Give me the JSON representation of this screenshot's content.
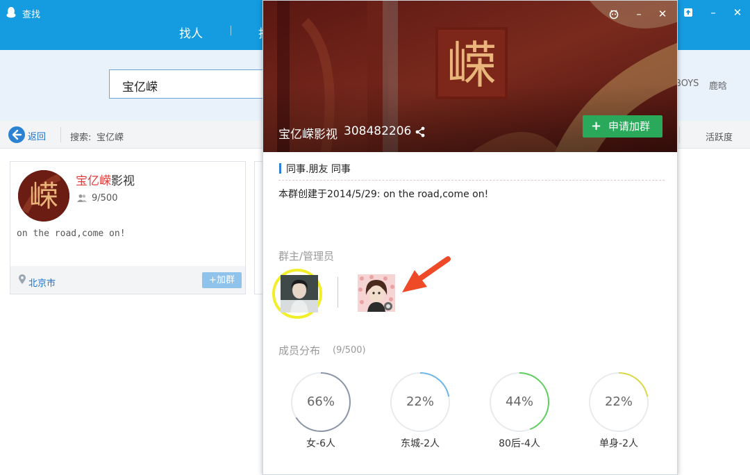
{
  "window": {
    "title": "查找",
    "nav_tabs": [
      "找人",
      "找群"
    ],
    "controls": [
      "skin-icon",
      "minimize-icon",
      "close-icon"
    ]
  },
  "search": {
    "value": "宝亿嵘",
    "hot_tags": [
      "BOYS",
      "鹿晗"
    ]
  },
  "toolbar": {
    "back_label": "返回",
    "search_prefix": "搜索:",
    "search_term": "宝亿嵘",
    "sort_label": "活跃度"
  },
  "result_card": {
    "name_highlight": "宝亿嵘",
    "name_rest": "影视",
    "members": "9/500",
    "description": "on the road,come on!",
    "location": "北京市",
    "join_button": "+加群"
  },
  "popup": {
    "logo_text": "嵘",
    "group_name": "宝亿嵘影视",
    "group_id": "308482206",
    "apply_button": "申请加群",
    "tags": "同事.朋友  同事",
    "created": "本群创建于2014/5/29:  on the road,come on!",
    "admin_title": "群主/管理员",
    "members_title": "成员分布",
    "members_count": "(9/500)",
    "distribution": [
      {
        "pct_text": "66%",
        "value": 0.66,
        "label": "女-6人",
        "color": "#8a96a8"
      },
      {
        "pct_text": "22%",
        "value": 0.22,
        "label": "东城-2人",
        "color": "#6fb8e8"
      },
      {
        "pct_text": "44%",
        "value": 0.44,
        "label": "80后-4人",
        "color": "#5fd05f"
      },
      {
        "pct_text": "22%",
        "value": 0.22,
        "label": "单身-2人",
        "color": "#d9d94a"
      }
    ]
  },
  "colors": {
    "titlebar": "#159be0",
    "accent_link": "#1d73c8",
    "highlight_red": "#e23b3b",
    "join_green": "#2aa95b",
    "owner_ring": "#f2ee2a",
    "arrow_red": "#ee4a28"
  }
}
